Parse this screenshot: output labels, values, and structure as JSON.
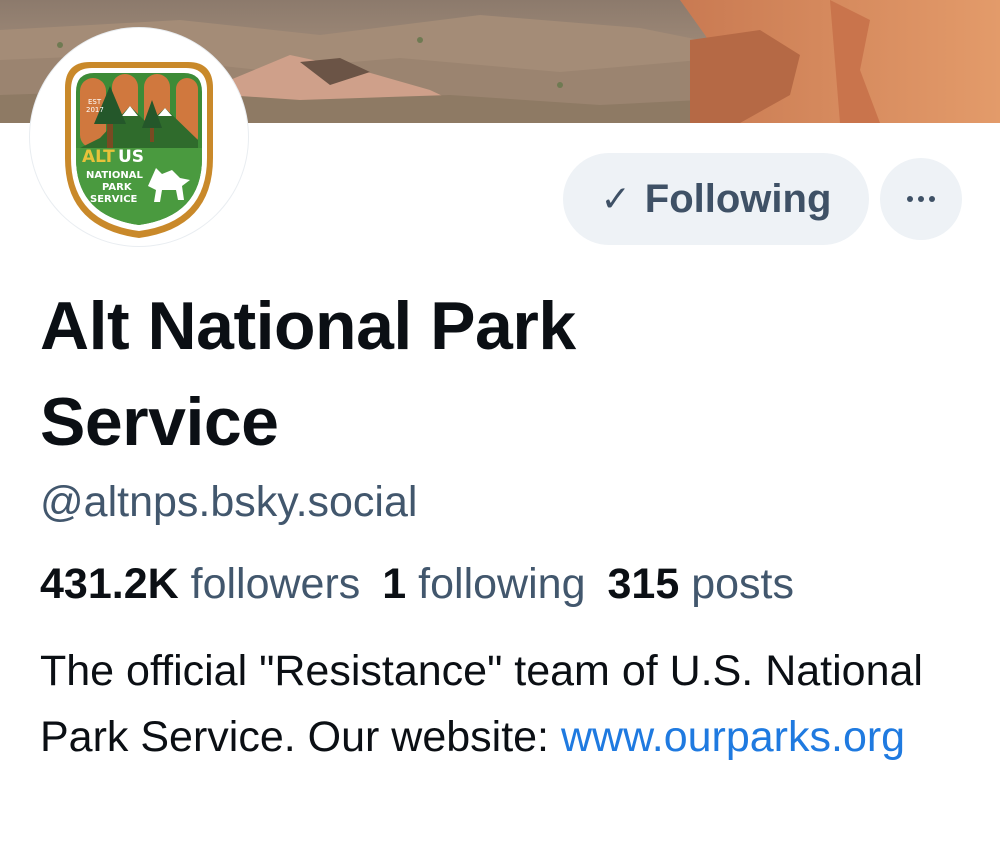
{
  "profile": {
    "display_name": "Alt National Park Service",
    "handle": "@altnps.bsky.social",
    "bio_text": "The official \"Resistance\" team of U.S. National Park Service. Our website: ",
    "bio_link": "www.ourparks.org",
    "avatar_logo": {
      "est_line1": "EST",
      "est_line2": "2017",
      "alt": "ALT",
      "us": "US",
      "line1": "NATIONAL",
      "line2": "PARK",
      "line3": "SERVICE"
    }
  },
  "actions": {
    "following_label": "Following",
    "check_icon": "check-icon",
    "more_icon": "ellipsis-icon"
  },
  "stats": {
    "followers_count": "431.2K",
    "followers_label": "followers",
    "following_count": "1",
    "following_label": "following",
    "posts_count": "315",
    "posts_label": "posts"
  },
  "colors": {
    "link": "#1f7ae0",
    "button_bg": "#eef2f6",
    "button_text": "#3f5166",
    "secondary_text": "#42576d",
    "primary_text": "#0b0f14"
  }
}
